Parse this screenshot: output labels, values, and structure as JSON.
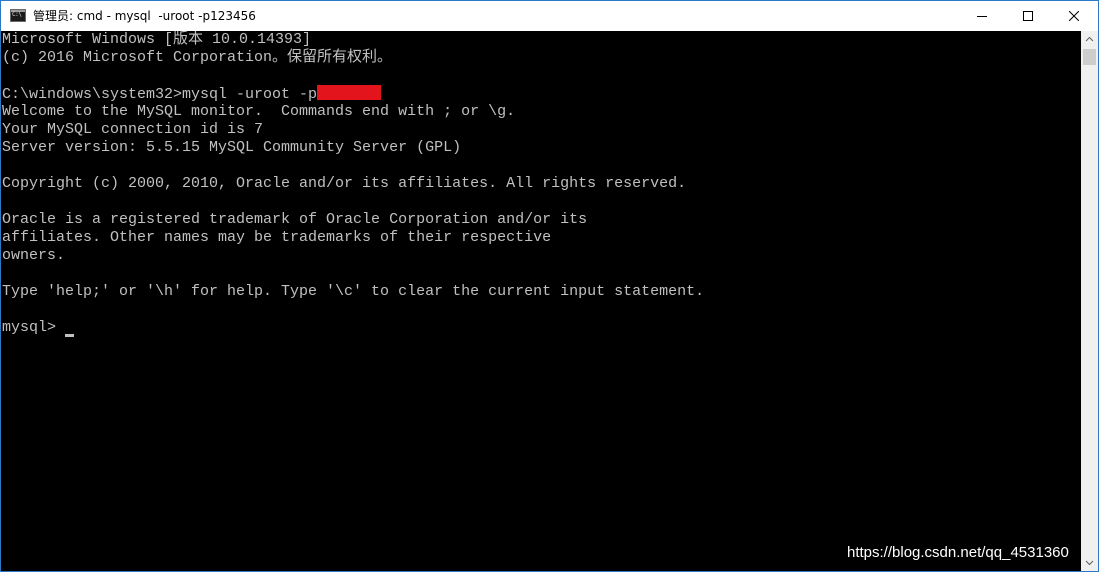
{
  "window": {
    "title": "管理员: cmd - mysql  -uroot -p123456",
    "icon": "cmd-console-icon",
    "icon_text": "C:\\",
    "controls": [
      "minimize-icon",
      "maximize-icon",
      "close-icon"
    ]
  },
  "console": {
    "lines": [
      "Microsoft Windows [版本 10.0.14393]",
      "(c) 2016 Microsoft Corporation。保留所有权利。",
      "",
      "C:\\windows\\system32>mysql -uroot -p",
      "Welcome to the MySQL monitor.  Commands end with ; or \\g.",
      "Your MySQL connection id is 7",
      "Server version: 5.5.15 MySQL Community Server (GPL)",
      "",
      "Copyright (c) 2000, 2010, Oracle and/or its affiliates. All rights reserved.",
      "",
      "Oracle is a registered trademark of Oracle Corporation and/or its",
      "affiliates. Other names may be trademarks of their respective",
      "owners.",
      "",
      "Type 'help;' or '\\h' for help. Type '\\c' to clear the current input statement.",
      "",
      "mysql> "
    ],
    "colors": {
      "background": "#000000",
      "foreground": "#c0c0c0",
      "redaction": "#e3141c"
    }
  },
  "watermark": "https://blog.csdn.net/qq_4531360"
}
